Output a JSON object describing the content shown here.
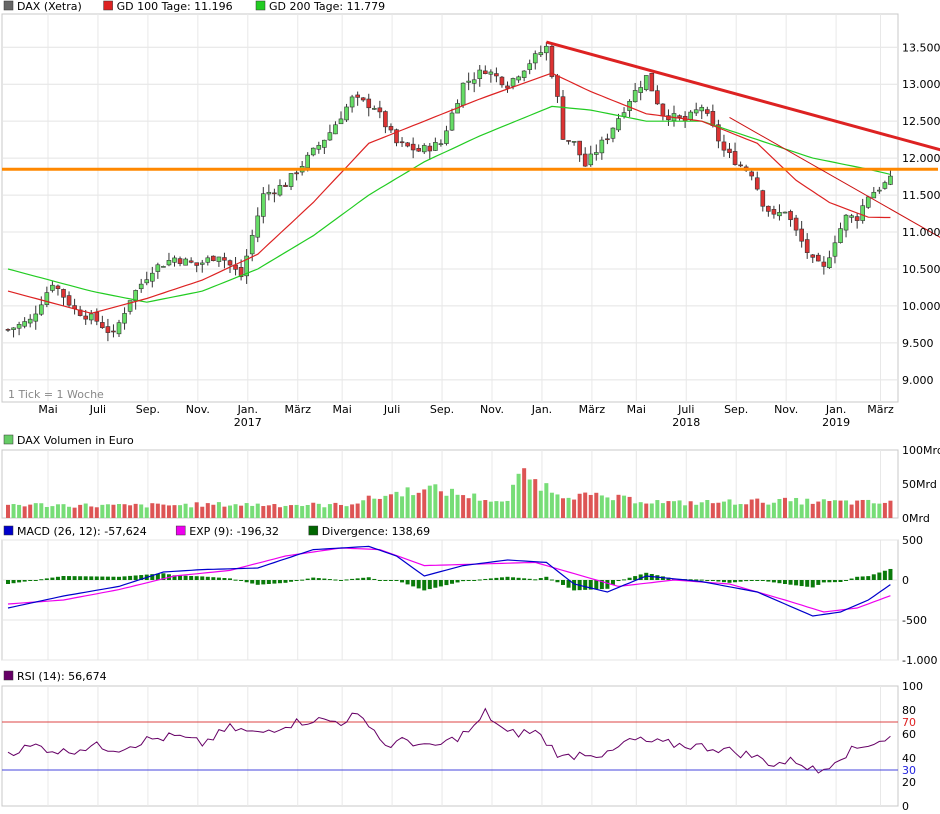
{
  "chart_data": [
    {
      "type": "candlestick",
      "legend": [
        {
          "label": "DAX (Xetra)",
          "color": "#666666"
        },
        {
          "label": "GD 100 Tage: 11.196",
          "color": "#dd2222"
        },
        {
          "label": "GD 200 Tage: 11.779",
          "color": "#22cc22"
        }
      ],
      "note": "1 Tick = 1 Woche",
      "y_ticks": [
        "13.500",
        "13.000",
        "12.500",
        "12.000",
        "11.500",
        "11.000",
        "10.500",
        "10.000",
        "9.500",
        "9.000"
      ],
      "y_tick_values": [
        13500,
        13000,
        12500,
        12000,
        11500,
        11000,
        10500,
        10000,
        9500,
        9000
      ],
      "ylim": [
        8700,
        13950
      ],
      "x_tick_labels": [
        "Mai",
        "Juli",
        "Sep.",
        "Nov.",
        "Jan.",
        "März",
        "Mai",
        "Juli",
        "Sep.",
        "Nov.",
        "Jan.",
        "März",
        "Mai",
        "Juli",
        "Sep.",
        "Nov.",
        "Jan.",
        "März"
      ],
      "year_labels": [
        "2017",
        "2018",
        "2019"
      ],
      "close_anchors": [
        [
          0,
          9680
        ],
        [
          4,
          9800
        ],
        [
          8,
          10320
        ],
        [
          12,
          9950
        ],
        [
          16,
          9800
        ],
        [
          19,
          9600
        ],
        [
          22,
          10100
        ],
        [
          26,
          10500
        ],
        [
          30,
          10650
        ],
        [
          34,
          10550
        ],
        [
          38,
          10700
        ],
        [
          42,
          10400
        ],
        [
          46,
          11500
        ],
        [
          50,
          11650
        ],
        [
          54,
          12000
        ],
        [
          58,
          12350
        ],
        [
          62,
          12800
        ],
        [
          66,
          12700
        ],
        [
          70,
          12200
        ],
        [
          74,
          12100
        ],
        [
          78,
          12200
        ],
        [
          82,
          13000
        ],
        [
          86,
          13200
        ],
        [
          90,
          13000
        ],
        [
          94,
          13300
        ],
        [
          97,
          13500
        ],
        [
          99,
          12800
        ],
        [
          100,
          12300
        ],
        [
          102,
          12200
        ],
        [
          104,
          11900
        ],
        [
          108,
          12300
        ],
        [
          112,
          12800
        ],
        [
          115,
          13100
        ],
        [
          118,
          12600
        ],
        [
          122,
          12500
        ],
        [
          125,
          12700
        ],
        [
          129,
          12100
        ],
        [
          132,
          11900
        ],
        [
          134,
          11800
        ],
        [
          136,
          11400
        ],
        [
          138,
          11200
        ],
        [
          140,
          11300
        ],
        [
          142,
          11000
        ],
        [
          145,
          10600
        ],
        [
          147,
          10500
        ],
        [
          149,
          10900
        ],
        [
          151,
          11200
        ],
        [
          153,
          11200
        ],
        [
          155,
          11500
        ],
        [
          157,
          11600
        ],
        [
          159,
          11700
        ]
      ],
      "sma100_anchors": [
        [
          0,
          10200
        ],
        [
          15,
          9900
        ],
        [
          25,
          10100
        ],
        [
          35,
          10350
        ],
        [
          45,
          10700
        ],
        [
          55,
          11400
        ],
        [
          65,
          12200
        ],
        [
          75,
          12500
        ],
        [
          85,
          12800
        ],
        [
          98,
          13150
        ],
        [
          105,
          12900
        ],
        [
          115,
          12600
        ],
        [
          125,
          12500
        ],
        [
          135,
          12200
        ],
        [
          142,
          11700
        ],
        [
          148,
          11400
        ],
        [
          155,
          11200
        ],
        [
          159,
          11196
        ]
      ],
      "sma200_anchors": [
        [
          0,
          10500
        ],
        [
          15,
          10200
        ],
        [
          25,
          10050
        ],
        [
          35,
          10200
        ],
        [
          45,
          10500
        ],
        [
          55,
          10950
        ],
        [
          65,
          11500
        ],
        [
          75,
          11950
        ],
        [
          85,
          12300
        ],
        [
          98,
          12700
        ],
        [
          105,
          12650
        ],
        [
          115,
          12500
        ],
        [
          125,
          12500
        ],
        [
          135,
          12250
        ],
        [
          145,
          12000
        ],
        [
          155,
          11850
        ],
        [
          159,
          11779
        ]
      ],
      "trendline": {
        "from": [
          97,
          13570
        ],
        "to": [
          165,
          12100
        ],
        "color": "#dd2222"
      },
      "trendline2": {
        "from": [
          130,
          12550
        ],
        "to": [
          165,
          10900
        ],
        "color": "#cc1111"
      },
      "support": {
        "y": 11850,
        "color": "#ff8800"
      }
    },
    {
      "type": "bar",
      "legend": [
        {
          "label": "DAX Volumen in Euro",
          "color": "#66cc66"
        }
      ],
      "y_ticks": [
        "100Mrd",
        "50Mrd",
        "0Mrd"
      ],
      "y_tick_values": [
        100,
        50,
        0
      ],
      "ylim": [
        0,
        100
      ],
      "values_anchor": [
        [
          0,
          20
        ],
        [
          20,
          18
        ],
        [
          40,
          20
        ],
        [
          60,
          19
        ],
        [
          75,
          45
        ],
        [
          90,
          22
        ],
        [
          92,
          65
        ],
        [
          100,
          35
        ],
        [
          120,
          22
        ],
        [
          140,
          25
        ],
        [
          159,
          22
        ]
      ]
    },
    {
      "type": "line",
      "legend": [
        {
          "label": "MACD (26, 12): -57,624",
          "color": "#0000cc"
        },
        {
          "label": "EXP (9): -196,32",
          "color": "#ee00ee"
        },
        {
          "label": "Divergence: 138,69",
          "color": "#006600"
        }
      ],
      "y_ticks": [
        "500",
        "0",
        "-500",
        "-1.000"
      ],
      "y_tick_values": [
        500,
        0,
        -500,
        -1000
      ],
      "ylim": [
        -1000,
        500
      ],
      "macd_anchors": [
        [
          0,
          -350
        ],
        [
          10,
          -200
        ],
        [
          20,
          -80
        ],
        [
          28,
          100
        ],
        [
          35,
          130
        ],
        [
          45,
          150
        ],
        [
          55,
          380
        ],
        [
          65,
          420
        ],
        [
          70,
          300
        ],
        [
          75,
          50
        ],
        [
          82,
          180
        ],
        [
          90,
          250
        ],
        [
          97,
          220
        ],
        [
          102,
          -50
        ],
        [
          108,
          -150
        ],
        [
          115,
          50
        ],
        [
          125,
          -20
        ],
        [
          135,
          -150
        ],
        [
          145,
          -450
        ],
        [
          150,
          -400
        ],
        [
          155,
          -250
        ],
        [
          159,
          -58
        ]
      ],
      "exp_anchors": [
        [
          0,
          -300
        ],
        [
          10,
          -250
        ],
        [
          20,
          -120
        ],
        [
          30,
          50
        ],
        [
          40,
          120
        ],
        [
          50,
          300
        ],
        [
          60,
          400
        ],
        [
          67,
          380
        ],
        [
          75,
          180
        ],
        [
          85,
          200
        ],
        [
          95,
          220
        ],
        [
          102,
          80
        ],
        [
          110,
          -80
        ],
        [
          120,
          0
        ],
        [
          130,
          -50
        ],
        [
          140,
          -250
        ],
        [
          147,
          -400
        ],
        [
          153,
          -350
        ],
        [
          159,
          -196
        ]
      ]
    },
    {
      "type": "line",
      "legend": [
        {
          "label": "RSI (14): 56,674",
          "color": "#660066"
        }
      ],
      "y_ticks": [
        "100",
        "80",
        "60",
        "40",
        "20",
        "0"
      ],
      "y_tick_values": [
        100,
        80,
        60,
        40,
        20,
        0
      ],
      "y_marker_labels": [
        "70",
        "30"
      ],
      "y_marker_values": [
        70,
        30
      ],
      "ylim": [
        0,
        100
      ],
      "rsi_anchors": [
        [
          0,
          45
        ],
        [
          5,
          50
        ],
        [
          10,
          45
        ],
        [
          15,
          50
        ],
        [
          20,
          48
        ],
        [
          25,
          55
        ],
        [
          30,
          58
        ],
        [
          35,
          52
        ],
        [
          40,
          65
        ],
        [
          45,
          60
        ],
        [
          50,
          68
        ],
        [
          55,
          72
        ],
        [
          60,
          70
        ],
        [
          62,
          75
        ],
        [
          65,
          70
        ],
        [
          68,
          50
        ],
        [
          72,
          55
        ],
        [
          76,
          48
        ],
        [
          80,
          55
        ],
        [
          84,
          65
        ],
        [
          86,
          78
        ],
        [
          90,
          60
        ],
        [
          95,
          62
        ],
        [
          100,
          40
        ],
        [
          104,
          45
        ],
        [
          108,
          42
        ],
        [
          112,
          55
        ],
        [
          118,
          52
        ],
        [
          124,
          50
        ],
        [
          128,
          48
        ],
        [
          134,
          42
        ],
        [
          138,
          35
        ],
        [
          142,
          38
        ],
        [
          146,
          28
        ],
        [
          150,
          42
        ],
        [
          155,
          52
        ],
        [
          159,
          57
        ]
      ]
    }
  ]
}
